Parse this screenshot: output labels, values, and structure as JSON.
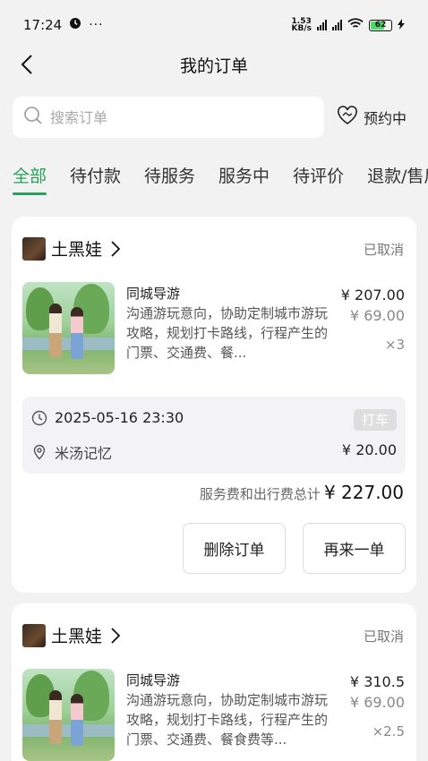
{
  "status_bar": {
    "time": "17:24",
    "net_speed_top": "1.53",
    "net_speed_unit": "KB/s",
    "battery": "62"
  },
  "nav": {
    "title": "我的订单"
  },
  "search": {
    "placeholder": "搜索订单"
  },
  "booking": {
    "label": "预约中"
  },
  "tabs": [
    {
      "label": "全部",
      "active": true
    },
    {
      "label": "待付款"
    },
    {
      "label": "待服务"
    },
    {
      "label": "服务中"
    },
    {
      "label": "待评价"
    },
    {
      "label": "退款/售后"
    }
  ],
  "accent_color": "#2aa05f",
  "orders": [
    {
      "shop": "土黑娃",
      "status": "已取消",
      "service_title": "同城导游",
      "service_desc": "沟通游玩意向，协助定制城市游玩攻略，规划打卡路线，行程产生的门票、交通费、餐...",
      "price": "¥ 207.00",
      "unit_price": "¥ 69.00",
      "quantity": "×3",
      "trip_time": "2025-05-16 23:30",
      "trip_tag": "打车",
      "trip_place": "米汤记忆",
      "trip_fee": "¥ 20.00",
      "total_label": "服务费和出行费总计",
      "total_amount": "¥ 227.00",
      "btn_delete": "删除订单",
      "btn_again": "再来一单"
    },
    {
      "shop": "土黑娃",
      "status": "已取消",
      "service_title": "同城导游",
      "service_desc": "沟通游玩意向，协助定制城市游玩攻略，规划打卡路线，行程产生的门票、交通费、餐食费等...",
      "price": "¥ 310.5",
      "unit_price": "¥ 69.00",
      "quantity": "×2.5"
    }
  ]
}
